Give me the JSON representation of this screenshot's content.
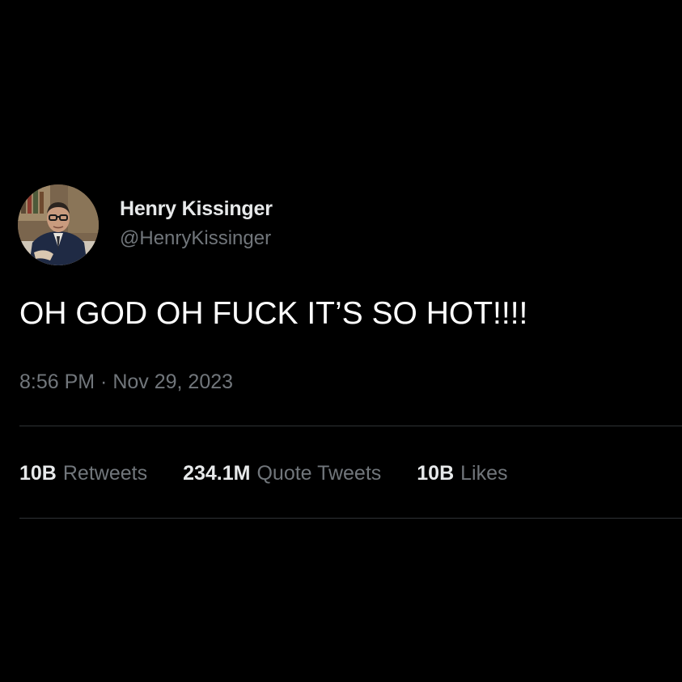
{
  "author": {
    "display_name": "Henry Kissinger",
    "handle": "@HenryKissinger",
    "avatar": "profile-photo"
  },
  "tweet": {
    "text": "OH GOD OH FUCK IT’S SO HOT!!!!",
    "timestamp": "8:56 PM · Nov 29, 2023"
  },
  "stats": [
    {
      "value": "10B",
      "label": "Retweets"
    },
    {
      "value": "234.1M",
      "label": "Quote Tweets"
    },
    {
      "value": "10B",
      "label": "Likes"
    }
  ],
  "colors": {
    "background": "#000000",
    "primary_text": "#e7e9ea",
    "secondary_text": "#71767b",
    "divider": "#2f3336"
  }
}
